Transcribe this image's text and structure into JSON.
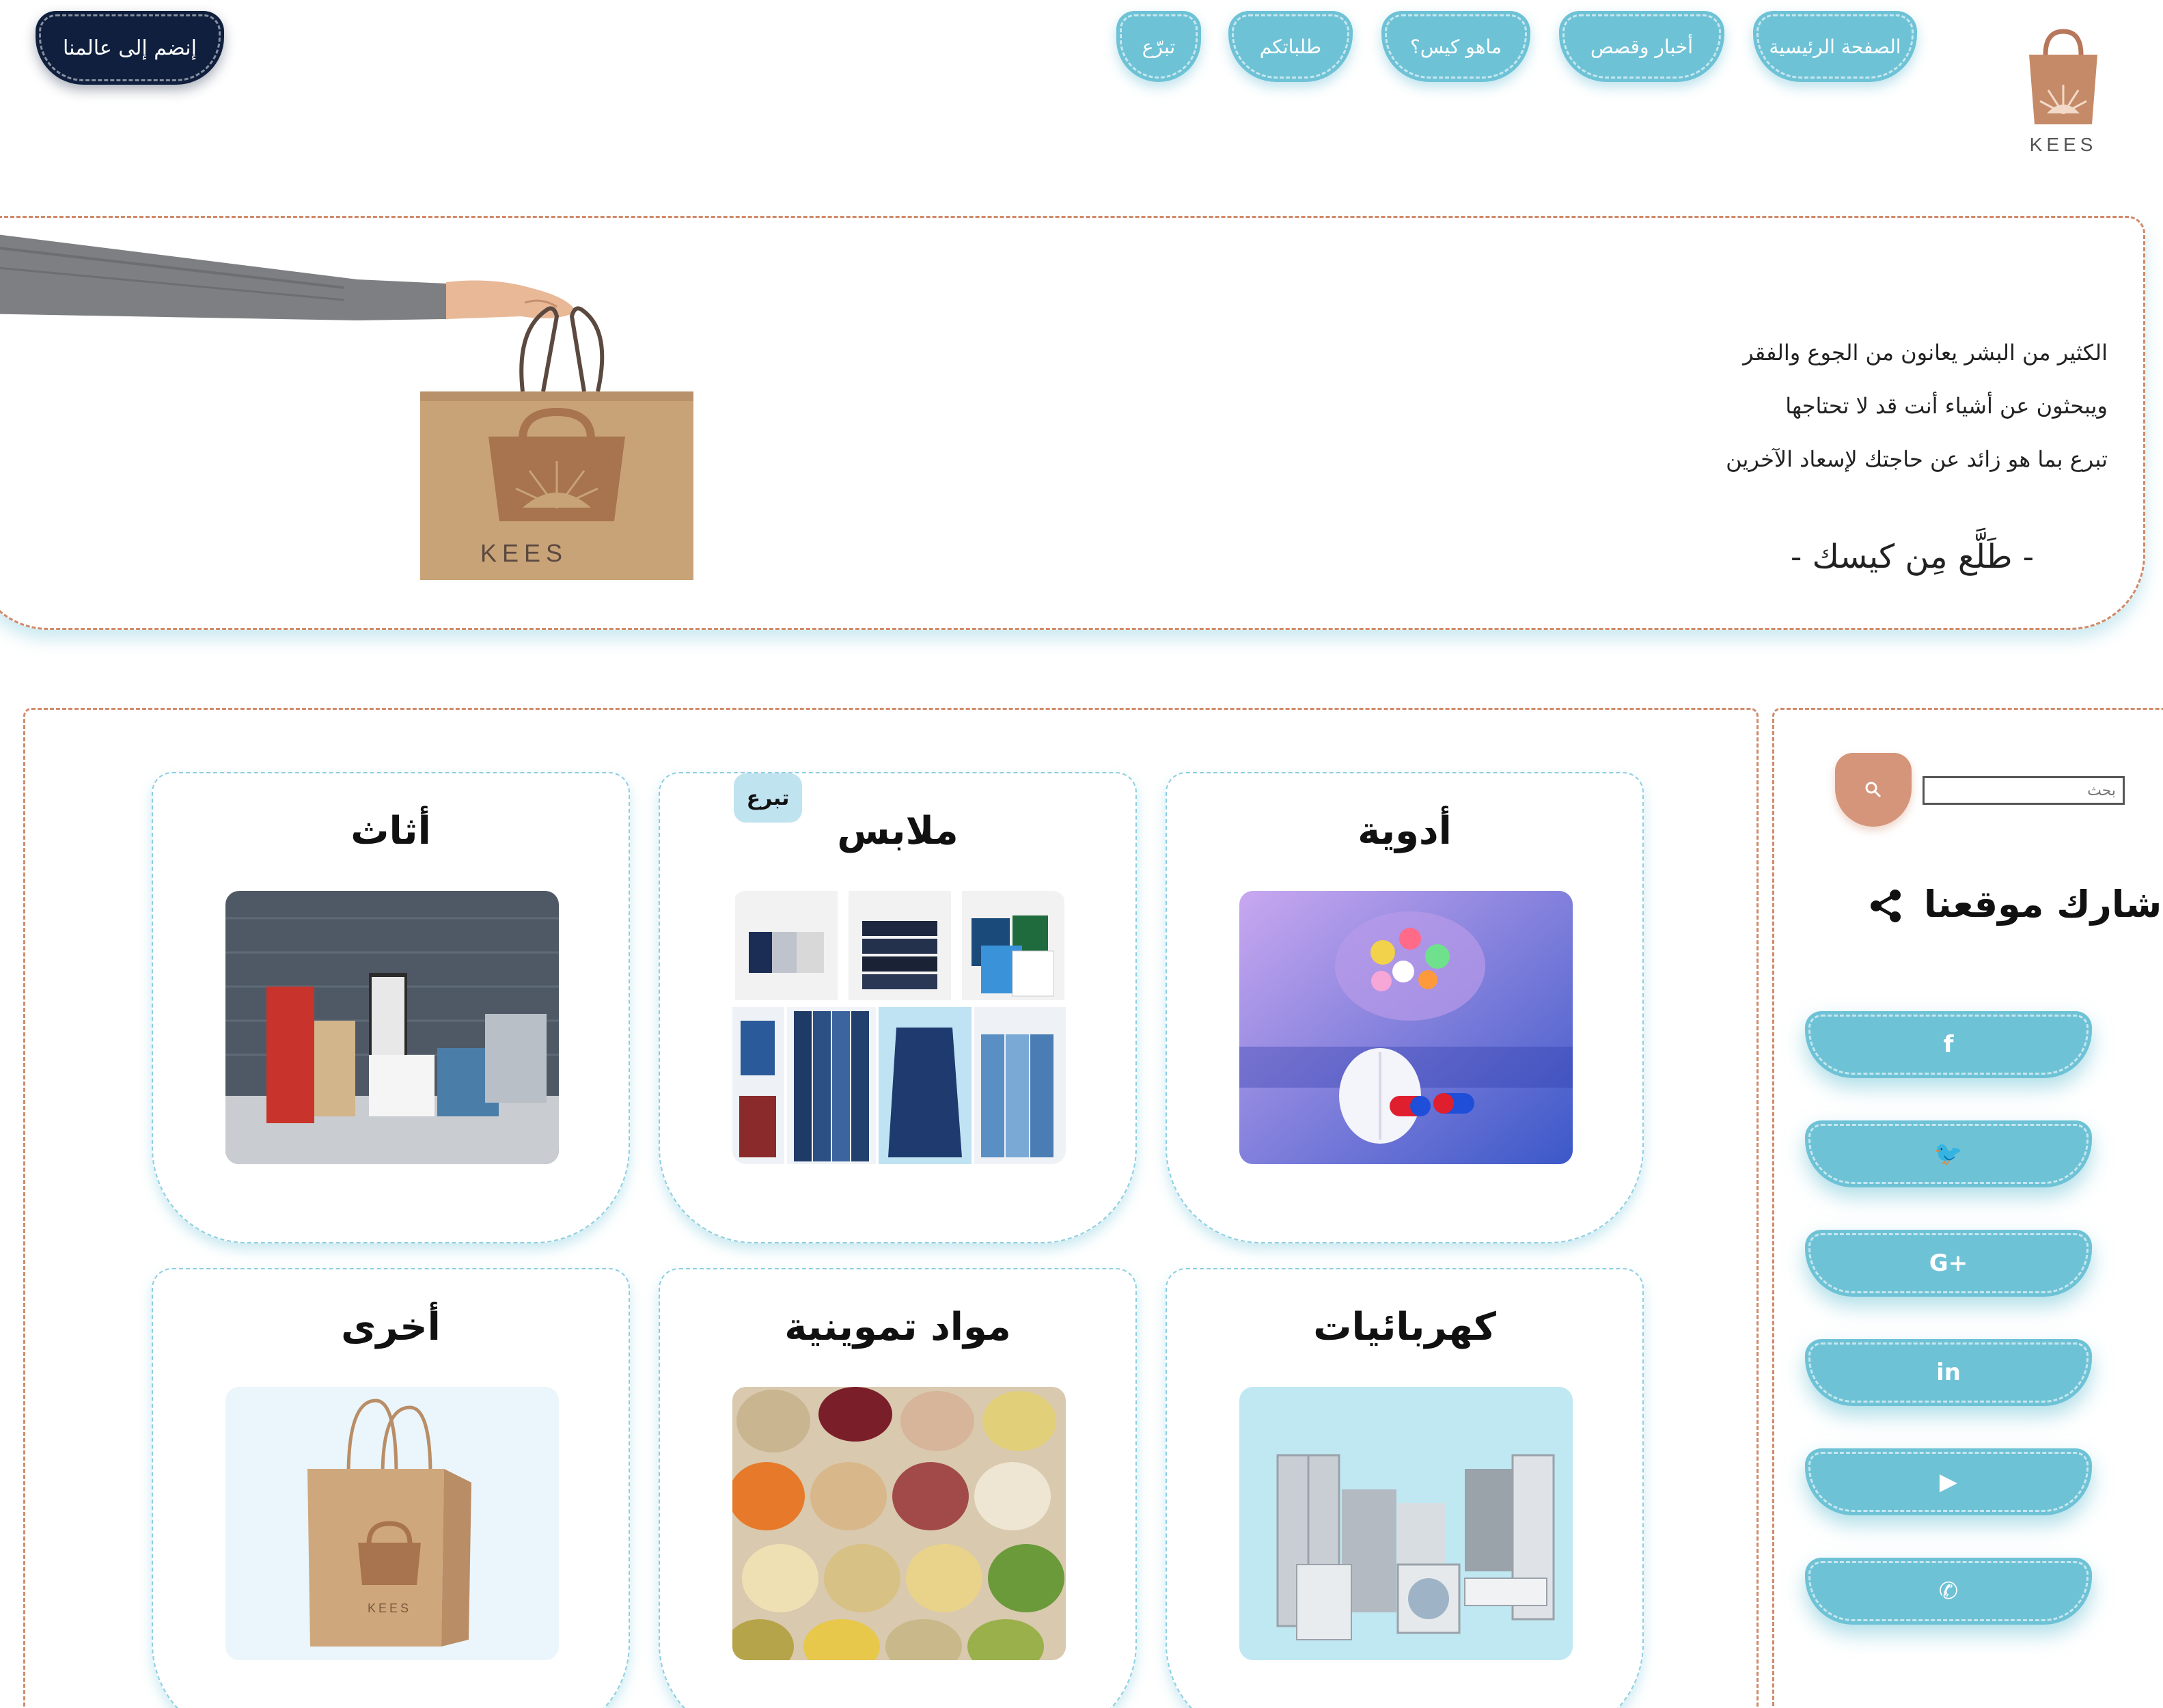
{
  "brand": {
    "name": "KEES"
  },
  "nav": {
    "items": [
      {
        "label": "الصفحة الرئيسية"
      },
      {
        "label": "أخبار وقصص"
      },
      {
        "label": "ماهو كيس؟"
      },
      {
        "label": "طلباتكم"
      },
      {
        "label": "تبرّع"
      }
    ],
    "join_label": "إنضم إلى عالمنا"
  },
  "hero": {
    "lines": [
      "الكثير من البشر يعانون من الجوع والفقر",
      "ويبحثون عن أشياء أنت قد لا تحتاجها",
      "تبرع بما هو زائد عن حاجتك لإسعاد الآخرين"
    ],
    "signature": "- طَلَّع مِن كيسك -",
    "bag_text": "KEES"
  },
  "categories": [
    {
      "title": "أدوية"
    },
    {
      "title": "ملابس"
    },
    {
      "title": "أثاث"
    },
    {
      "title": "كهربائيات"
    },
    {
      "title": "مواد تموينية"
    },
    {
      "title": "أخرى"
    }
  ],
  "clothes_badge": "تبرع",
  "search": {
    "placeholder": "بحث"
  },
  "share": {
    "title": "شارك موقعنا",
    "buttons": [
      {
        "icon": "facebook-icon",
        "glyph": "f"
      },
      {
        "icon": "twitter-icon",
        "glyph": "🐦"
      },
      {
        "icon": "google-plus-icon",
        "glyph": "G+"
      },
      {
        "icon": "linkedin-icon",
        "glyph": "in"
      },
      {
        "icon": "youtube-icon",
        "glyph": "▶"
      },
      {
        "icon": "whatsapp-icon",
        "glyph": "✆"
      }
    ]
  },
  "colors": {
    "accent": "#6ec2d6",
    "navy": "#0f1f3d",
    "terracotta": "#d4957a",
    "dash": "#d08a6a"
  }
}
